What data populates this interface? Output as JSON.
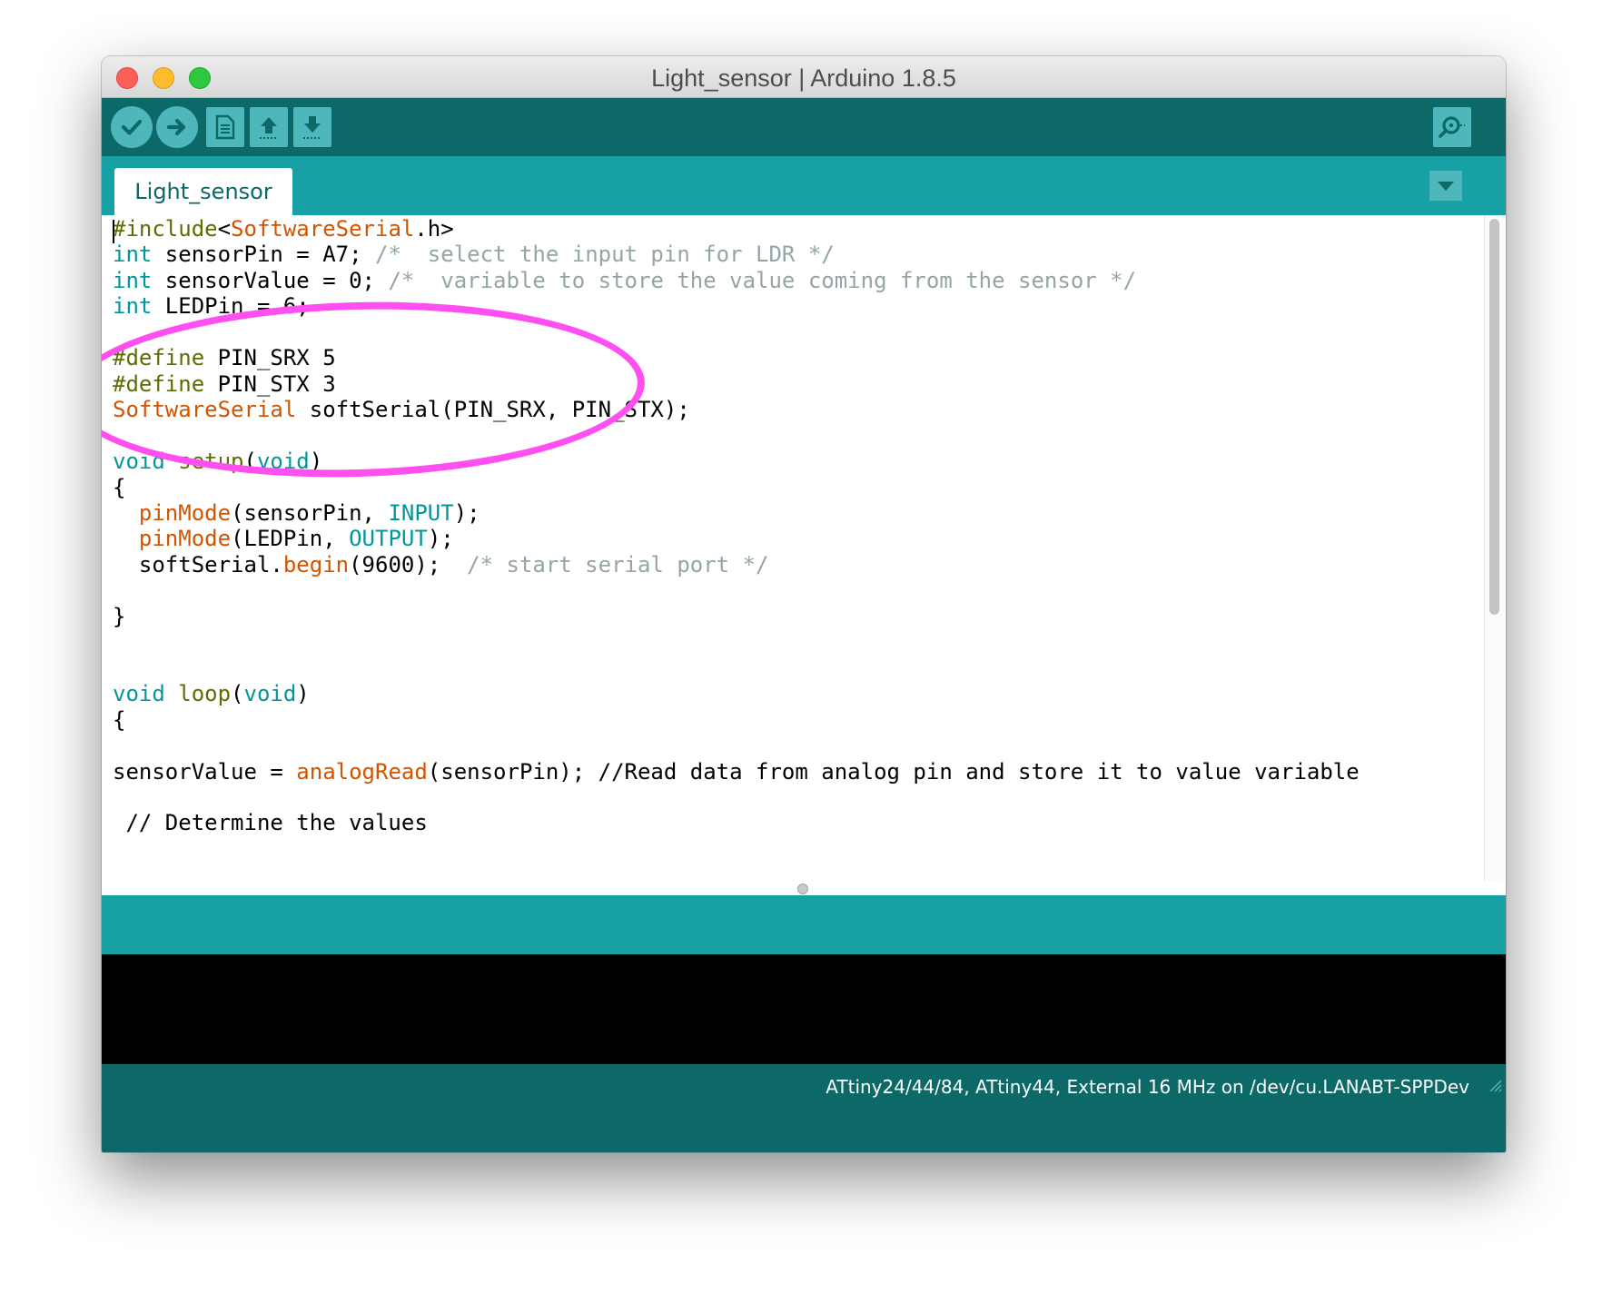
{
  "window": {
    "title": "Light_sensor | Arduino 1.8.5"
  },
  "toolbar": {
    "buttons": [
      {
        "name": "verify",
        "icon": "checkmark-icon"
      },
      {
        "name": "upload",
        "icon": "arrow-right-icon"
      },
      {
        "name": "new",
        "icon": "new-file-icon"
      },
      {
        "name": "open",
        "icon": "arrow-up-icon"
      },
      {
        "name": "save",
        "icon": "arrow-down-icon"
      },
      {
        "name": "serial-monitor",
        "icon": "magnifier-icon"
      }
    ]
  },
  "tabs": {
    "active": "Light_sensor",
    "menu_icon": "triangle-down-icon"
  },
  "code": {
    "lines": [
      [
        [
          "dir",
          "#include"
        ],
        [
          "",
          "<"
        ],
        [
          "fn",
          "SoftwareSerial"
        ],
        [
          "",
          ".h>"
        ]
      ],
      [
        [
          "kw",
          "int"
        ],
        [
          "",
          " sensorPin = A7; "
        ],
        [
          "cm",
          "/*  select the input pin for LDR */"
        ]
      ],
      [
        [
          "kw",
          "int"
        ],
        [
          "",
          " sensorValue = 0; "
        ],
        [
          "cm",
          "/*  variable to store the value coming from the sensor */"
        ]
      ],
      [
        [
          "kw",
          "int"
        ],
        [
          "",
          " LEDPin = 6;"
        ]
      ],
      [],
      [
        [
          "dir",
          "#define"
        ],
        [
          "",
          " PIN_SRX 5"
        ]
      ],
      [
        [
          "dir",
          "#define"
        ],
        [
          "",
          " PIN_STX 3"
        ]
      ],
      [
        [
          "fn",
          "SoftwareSerial"
        ],
        [
          "",
          " softSerial(PIN_SRX, PIN_STX);"
        ]
      ],
      [],
      [
        [
          "kw",
          "void"
        ],
        [
          "",
          " "
        ],
        [
          "dir",
          "setup"
        ],
        [
          "",
          "("
        ],
        [
          "kw",
          "void"
        ],
        [
          "",
          ")"
        ]
      ],
      [
        [
          "",
          "{"
        ]
      ],
      [
        [
          "",
          "  "
        ],
        [
          "fn",
          "pinMode"
        ],
        [
          "",
          "(sensorPin, "
        ],
        [
          "kw",
          "INPUT"
        ],
        [
          "",
          ");"
        ]
      ],
      [
        [
          "",
          "  "
        ],
        [
          "fn",
          "pinMode"
        ],
        [
          "",
          "(LEDPin, "
        ],
        [
          "kw",
          "OUTPUT"
        ],
        [
          "",
          ");"
        ]
      ],
      [
        [
          "",
          "  softSerial."
        ],
        [
          "fn",
          "begin"
        ],
        [
          "",
          "(9600);  "
        ],
        [
          "cm",
          "/* start serial port */"
        ]
      ],
      [],
      [
        [
          "",
          "}"
        ]
      ],
      [],
      [],
      [
        [
          "kw",
          "void"
        ],
        [
          "",
          " "
        ],
        [
          "dir",
          "loop"
        ],
        [
          "",
          "("
        ],
        [
          "kw",
          "void"
        ],
        [
          "",
          ")"
        ]
      ],
      [
        [
          "",
          "{"
        ]
      ],
      [],
      [
        [
          "",
          "sensorValue = "
        ],
        [
          "fn",
          "analogRead"
        ],
        [
          "",
          "(sensorPin); //Read data from analog pin and store it to value variable"
        ]
      ],
      [],
      [
        [
          "",
          "",
          " "
        ],
        [
          "",
          ""
        ],
        [
          "",
          ""
        ]
      ],
      [
        [
          "",
          ""
        ]
      ]
    ]
  },
  "status": {
    "board": "ATtiny24/44/84, ATtiny44, External 16 MHz on /dev/cu.LANABT-SPPDev"
  },
  "colors": {
    "toolbar_bg": "#0d6868",
    "tabbar_bg": "#17a1a5",
    "button_bg": "#4db7bb",
    "keyword": "#00979c",
    "function": "#d35400",
    "directive": "#5e6d03",
    "comment": "#95a5a6",
    "highlight_ellipse": "#ff4ff0"
  }
}
